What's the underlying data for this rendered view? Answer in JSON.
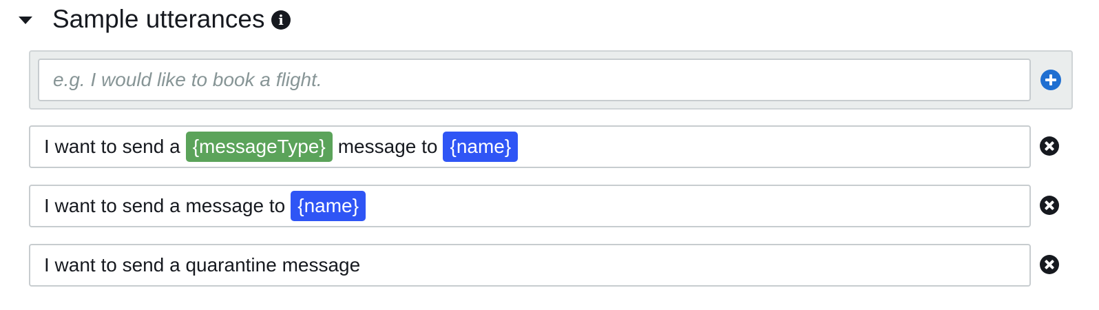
{
  "section": {
    "title": "Sample utterances",
    "info_icon": "info-icon",
    "collapse_icon": "caret-down-icon"
  },
  "new_utterance": {
    "placeholder": "e.g. I would like to book a flight.",
    "value": "",
    "add_icon": "plus-circle-icon"
  },
  "utterances": [
    {
      "segments": [
        {
          "type": "text",
          "value": "I want to send a"
        },
        {
          "type": "slot",
          "value": "{messageType}",
          "color": "#5ba35a"
        },
        {
          "type": "text",
          "value": "message to"
        },
        {
          "type": "slot",
          "value": "{name}",
          "color": "#2f55f5"
        }
      ]
    },
    {
      "segments": [
        {
          "type": "text",
          "value": "I want to send a message to"
        },
        {
          "type": "slot",
          "value": "{name}",
          "color": "#2f55f5"
        }
      ]
    },
    {
      "segments": [
        {
          "type": "text",
          "value": "I want to send a quarantine message"
        }
      ]
    }
  ],
  "remove_icon": "close-circle-icon",
  "colors": {
    "slot_green": "#5ba35a",
    "slot_blue": "#2f55f5",
    "add_blue": "#1f6fd1",
    "panel_bg": "#eaeded"
  }
}
